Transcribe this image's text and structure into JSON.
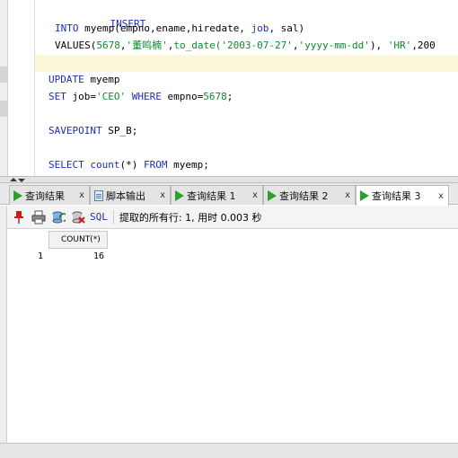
{
  "editor": {
    "lines": {
      "l1": "INSERT",
      "l2a": "INTO ",
      "l2b": "myemp(empno,ename,hiredate, ",
      "l2c": "job",
      "l2d": ", sal)",
      "l3a": "VALUES(",
      "l3b": "5678",
      "l3c": ",",
      "l3d": "'董鸣楠'",
      "l3e": ",",
      "l3f": "to_date(",
      "l3g": "'2003-07-27'",
      "l3h": ",",
      "l3i": "'yyyy-mm-dd'",
      "l3j": "), ",
      "l3k": "'HR'",
      "l3l": ",200",
      "l4a": "UPDATE ",
      "l4b": "myemp",
      "l5a": "SET ",
      "l5b": "job",
      "l5c": "=",
      "l5d": "'CEO'",
      "l5e": " WHERE ",
      "l5f": "empno=",
      "l5g": "5678",
      "l5h": ";",
      "l6a": "SAVEPOINT ",
      "l6b": "SP_B;",
      "l7a": "SELECT ",
      "l7b": "count",
      "l7c": "(*) ",
      "l7d": "FROM ",
      "l7e": "myemp;"
    }
  },
  "tabs": [
    {
      "label": "查询结果",
      "close": "x"
    },
    {
      "label": "脚本输出",
      "close": "x"
    },
    {
      "label": "查询结果 1",
      "close": "x"
    },
    {
      "label": "查询结果 2",
      "close": "x"
    },
    {
      "label": "查询结果 3",
      "close": "x"
    }
  ],
  "toolbar": {
    "sql_label": "SQL",
    "separator": "|",
    "status": "提取的所有行: 1, 用时 0.003 秒"
  },
  "grid": {
    "columns": [
      "COUNT(*)"
    ],
    "rows": [
      {
        "num": "1",
        "values": [
          "16"
        ]
      }
    ]
  },
  "colors": {
    "keyword": "#1f2eb8",
    "string": "#0b8a2c",
    "tab_play": "#2aa12a",
    "highlight_line": "#fcf7d8"
  }
}
